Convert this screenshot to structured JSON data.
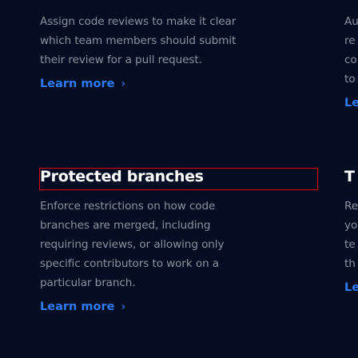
{
  "features": [
    {
      "title": "",
      "description_lines": [
        "Assign code reviews to make it clear",
        "which team members should submit",
        "their review for a pull request."
      ],
      "link_label": "Learn more",
      "link_icon": "chevron-right-icon"
    },
    {
      "title": "Protected branches",
      "description_lines": [
        "Enforce restrictions on how code",
        "branches are merged, including",
        "requiring reviews, or allowing only",
        "specific contributors to work on a",
        "particular branch."
      ],
      "link_label": "Learn more",
      "link_icon": "chevron-right-icon",
      "highlighted": true
    }
  ],
  "right_column": {
    "top_fragments": [
      "Au",
      "re",
      "co",
      "to"
    ],
    "top_link": "Le",
    "second_title": "T",
    "second_fragments": [
      "Re",
      "yo",
      "te",
      "th"
    ],
    "second_link": "Le"
  },
  "colors": {
    "background": "#040d21",
    "text": "#8b919e",
    "link": "#2f7bf5",
    "heading": "#ffffff",
    "highlight": "#e00000"
  }
}
